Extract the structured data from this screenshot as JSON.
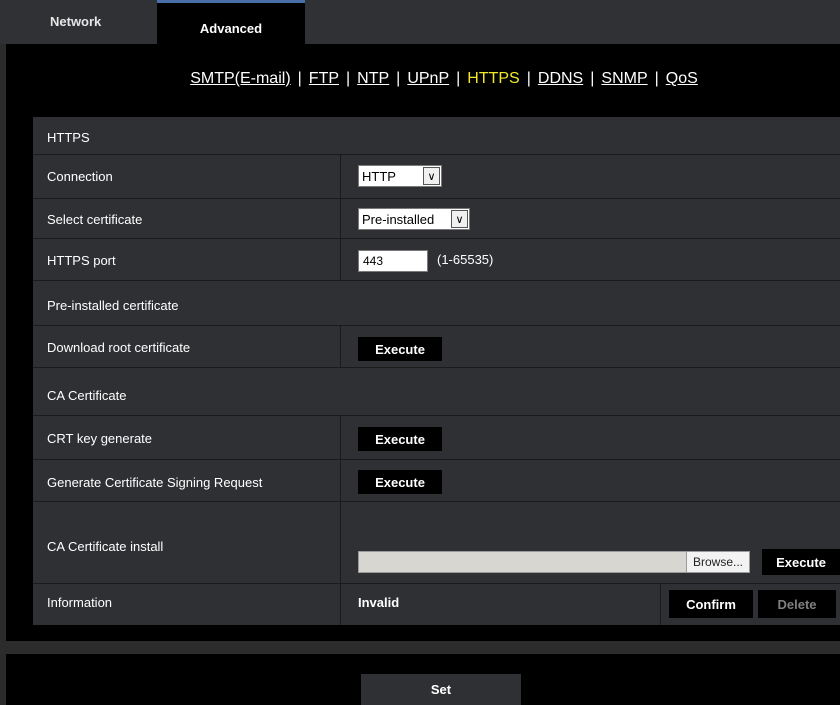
{
  "tabs": {
    "network": "Network",
    "advanced": "Advanced"
  },
  "subnav": {
    "items": [
      "SMTP(E-mail)",
      "FTP",
      "NTP",
      "UPnP",
      "HTTPS",
      "DDNS",
      "SNMP",
      "QoS"
    ],
    "separator": "|",
    "active": "HTTPS"
  },
  "https": {
    "section_title": "HTTPS",
    "connection": {
      "label": "Connection",
      "value": "HTTP"
    },
    "select_certificate": {
      "label": "Select certificate",
      "value": "Pre-installed"
    },
    "https_port": {
      "label": "HTTPS port",
      "value": "443",
      "range": "(1-65535)"
    }
  },
  "preinstalled": {
    "section_title": "Pre-installed certificate",
    "download_root": {
      "label": "Download root certificate",
      "button": "Execute"
    }
  },
  "ca": {
    "section_title": "CA Certificate",
    "crt_key": {
      "label": "CRT key generate",
      "button": "Execute"
    },
    "csr": {
      "label": "Generate Certificate Signing Request",
      "button": "Execute"
    },
    "install": {
      "label": "CA Certificate install",
      "browse": "Browse...",
      "button": "Execute"
    },
    "information": {
      "label": "Information",
      "value": "Invalid",
      "confirm": "Confirm",
      "delete": "Delete"
    }
  },
  "footer": {
    "set": "Set"
  },
  "colors": {
    "panel": "#2f3034",
    "active_link": "#f0e92a",
    "background": "#000000"
  }
}
